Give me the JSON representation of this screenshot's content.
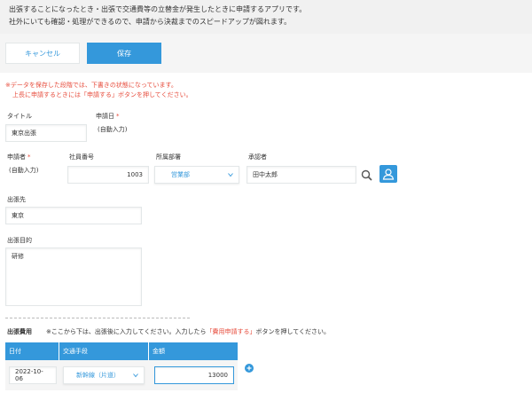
{
  "description": {
    "line1": "出張することになったとき・出張で交通費等の立替金が発生したときに申請するアプリです。",
    "line2": "社外にいても確認・処理ができるので、申請から決裁までのスピードアップが図れます。"
  },
  "toolbar": {
    "cancel_label": "キャンセル",
    "save_label": "保存"
  },
  "notice": {
    "line1": "※データを保存した段階では、下書きの状態になっています。",
    "line2": "上長に申請するときには「申請する」ボタンを押してください。"
  },
  "fields": {
    "title": {
      "label": "タイトル",
      "value": "東京出張"
    },
    "apply_date": {
      "label": "申請日",
      "required_mark": "*",
      "value": "(自動入力)"
    },
    "applicant": {
      "label": "申請者",
      "required_mark": "*",
      "value": "(自動入力)"
    },
    "employee_no": {
      "label": "社員番号",
      "value": "1003"
    },
    "department": {
      "label": "所属部署",
      "value": "営業部"
    },
    "approver": {
      "label": "承認者",
      "value": "田中太郎"
    },
    "destination": {
      "label": "出張先",
      "value": "東京"
    },
    "purpose": {
      "label": "出張目的",
      "value": "研修"
    }
  },
  "expenses": {
    "section_label": "出張費用",
    "note_prefix": "※ここから下は、出張後に入力してください。入力したら",
    "note_highlight": "「費用申請する」",
    "note_suffix": "ボタンを押してください。",
    "columns": [
      "日付",
      "交通手段",
      "金額"
    ],
    "rows": [
      {
        "date": "2022-10-06",
        "transport": "新幹線（片道）",
        "amount": "13000"
      }
    ]
  },
  "colors": {
    "accent": "#3498db",
    "required": "#e74c3c",
    "background": "#f5f5f5"
  },
  "icons": {
    "search": "search-icon",
    "user": "user-icon",
    "chevron": "chevron-down-icon",
    "add": "add-row-icon"
  }
}
